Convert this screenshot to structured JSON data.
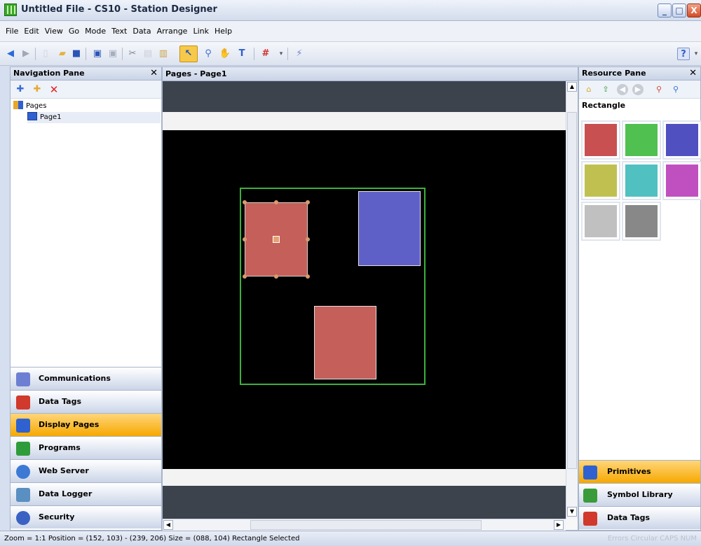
{
  "window": {
    "title": "Untitled File - CS10 - Station Designer"
  },
  "menu": [
    "File",
    "Edit",
    "View",
    "Go",
    "Mode",
    "Text",
    "Data",
    "Arrange",
    "Link",
    "Help"
  ],
  "nav_pane": {
    "title": "Navigation Pane",
    "tree_root": "Pages",
    "tree_child": "Page1",
    "buttons": [
      {
        "label": "Communications",
        "icon": "communications-icon",
        "color": "#6d7fd2"
      },
      {
        "label": "Data Tags",
        "icon": "data-tags-icon",
        "color": "#d0392b"
      },
      {
        "label": "Display Pages",
        "icon": "display-pages-icon",
        "color": "#2f62d0",
        "active": true
      },
      {
        "label": "Programs",
        "icon": "programs-icon",
        "color": "#2f9c3b"
      },
      {
        "label": "Web Server",
        "icon": "web-server-icon",
        "color": "#3d7ad5"
      },
      {
        "label": "Data Logger",
        "icon": "data-logger-icon",
        "color": "#5a8fc2"
      },
      {
        "label": "Security",
        "icon": "security-icon",
        "color": "#3a62c3"
      }
    ]
  },
  "editor": {
    "title": "Pages - Page1",
    "shapes": [
      {
        "name": "rect-red-selected",
        "fill": "#c55f5a"
      },
      {
        "name": "rect-blue",
        "fill": "#5f60c7"
      },
      {
        "name": "rect-red-bottom",
        "fill": "#c55f5a"
      }
    ],
    "group_color": "#3cb03c"
  },
  "resource_pane": {
    "title": "Resource Pane",
    "section_title": "Rectangle",
    "swatches": [
      "#c95050",
      "#50c050",
      "#5050c0",
      "#c0c050",
      "#50c0c0",
      "#c050c0",
      "#c0c0c0",
      "#888888"
    ],
    "buttons": [
      {
        "label": "Primitives",
        "icon": "primitives-icon",
        "active": true
      },
      {
        "label": "Symbol Library",
        "icon": "symbol-library-icon"
      },
      {
        "label": "Data Tags",
        "icon": "data-tags-icon"
      }
    ]
  },
  "status": {
    "text": "Zoom = 1:1  Position = (152, 103) - (239, 206)  Size = (088, 104)  Rectangle Selected",
    "right": "Errors  Circular  CAPS  NUM"
  }
}
